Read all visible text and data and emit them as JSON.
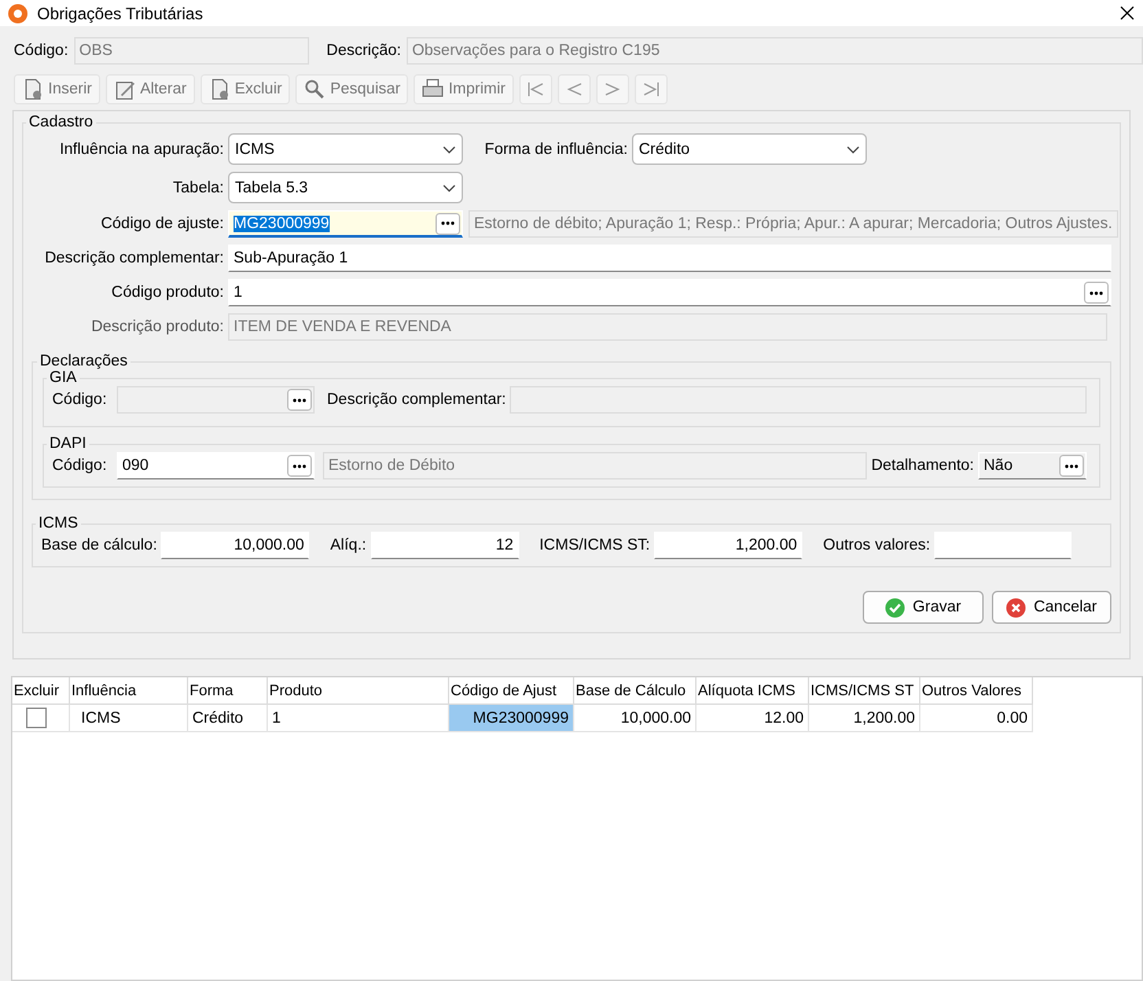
{
  "window": {
    "title": "Obrigações Tributárias"
  },
  "header": [
    {
      "label": "Código:",
      "value": "OBS"
    },
    {
      "label": "Descrição:",
      "value": "Observações para o Registro C195"
    }
  ],
  "toolbar": [
    {
      "kind": "labeled",
      "label": "Inserir",
      "disabled": true
    },
    {
      "kind": "labeled",
      "label": "Alterar",
      "disabled": true
    },
    {
      "kind": "labeled",
      "label": "Excluir",
      "disabled": true
    },
    {
      "kind": "labeled",
      "label": "Pesquisar",
      "disabled": true
    },
    {
      "kind": "labeled",
      "label": "Imprimir",
      "disabled": true
    },
    {
      "kind": "nav",
      "disabled": true
    },
    {
      "kind": "nav",
      "disabled": true
    },
    {
      "kind": "nav",
      "disabled": true
    },
    {
      "kind": "nav",
      "disabled": true
    }
  ],
  "cadastro": {
    "title": "Cadastro",
    "influencia": {
      "label": "Influência na apuração:",
      "value": "ICMS"
    },
    "forma": {
      "label": "Forma de influência:",
      "value": "Crédito"
    },
    "tabela": {
      "label": "Tabela:",
      "value": "Tabela 5.3"
    },
    "codigo_ajuste": {
      "label": "Código de ajuste:",
      "value": "MG23000999",
      "focused": true,
      "description": "Estorno de débito; Apuração 1; Resp.: Própria; Apur.: A apurar; Mercadoria; Outros Ajustes."
    },
    "descricao_complementar": {
      "label": "Descrição complementar:",
      "value": "Sub-Apuração 1"
    },
    "codigo_produto": {
      "label": "Código produto:",
      "value": "1"
    },
    "descricao_produto": {
      "label": "Descrição produto:",
      "value": "ITEM DE VENDA E REVENDA"
    }
  },
  "declaracoes": {
    "title": "Declarações",
    "gia": {
      "title": "GIA",
      "codigo_label": "Código:",
      "descricao_label": "Descrição complementar:"
    },
    "dapi": {
      "title": "DAPI",
      "codigo_label": "Código:",
      "codigo": "090",
      "descricao": "Estorno de Débito",
      "detalhamento_label": "Detalhamento:",
      "detalhamento": "Não"
    }
  },
  "icms": {
    "title": "ICMS",
    "fields": [
      {
        "label": "Base de cálculo:",
        "value": "10,000.00"
      },
      {
        "label": "Alíq.:",
        "value": "12"
      },
      {
        "label": "ICMS/ICMS ST:",
        "value": "1,200.00"
      },
      {
        "label": "Outros valores:"
      }
    ]
  },
  "buttons": [
    {
      "kind": "save",
      "label": "Gravar"
    },
    {
      "kind": "cancel",
      "label": "Cancelar"
    }
  ],
  "table": {
    "columns": [
      "Excluir",
      "Influência",
      "Forma",
      "Produto",
      "Código de Ajust",
      "Base de Cálculo",
      "Alíquota ICMS",
      "ICMS/ICMS ST",
      "Outros Valores"
    ],
    "rows": [
      {
        "cells": [
          {
            "kind": "checkbox",
            "checked": false
          },
          {
            "text": "ICMS",
            "selected": false
          },
          {
            "text": "Crédito",
            "selected": false
          },
          {
            "text": "1",
            "selected": false
          },
          {
            "text": "MG23000999",
            "selected": true
          },
          {
            "text": "10,000.00",
            "selected": false
          },
          {
            "text": "12.00",
            "selected": false
          },
          {
            "text": "1,200.00",
            "selected": false
          },
          {
            "text": "0.00",
            "selected": false
          }
        ]
      }
    ]
  }
}
